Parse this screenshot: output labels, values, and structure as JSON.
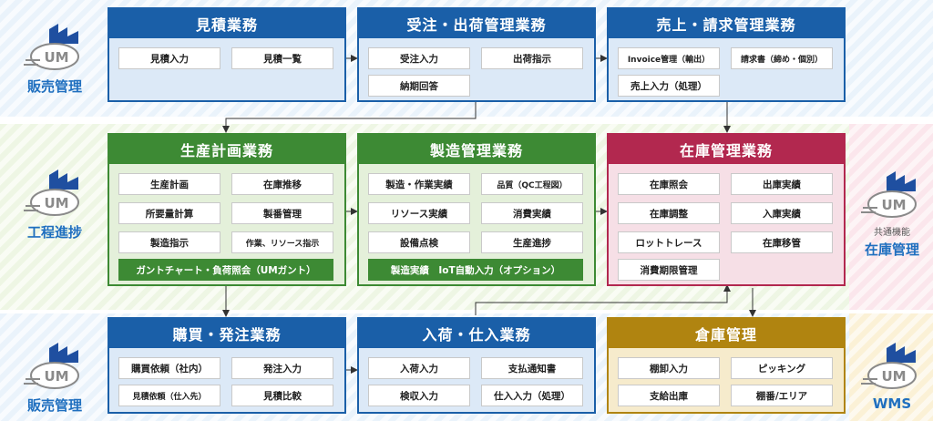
{
  "side_labels": {
    "top": "販売管理",
    "mid": "工程進捗",
    "bot": "販売管理",
    "right_mid_sub": "共通機能",
    "right_mid": "在庫管理",
    "right_bot": "WMS",
    "logo_text": "UM"
  },
  "boxes": {
    "mitsumori": {
      "title": "見積業務",
      "items": [
        "見積入力",
        "見積一覧"
      ]
    },
    "juchu": {
      "title": "受注・出荷管理業務",
      "items": [
        "受注入力",
        "出荷指示",
        "納期回答"
      ]
    },
    "uriage": {
      "title": "売上・請求管理業務",
      "items": [
        "Invoice管理（輸出）",
        "請求書（締め・個別）",
        "売上入力（処理）"
      ]
    },
    "seisan": {
      "title": "生産計画業務",
      "items": [
        "生産計画",
        "在庫推移",
        "所要量計算",
        "製番管理",
        "製造指示",
        "作業、リソース指示"
      ],
      "bar": "ガントチャート・負荷照会（UMガント）"
    },
    "seizo": {
      "title": "製造管理業務",
      "items": [
        "製造・作業実績",
        "品質（QC工程図）",
        "リソース実績",
        "消費実績",
        "設備点検",
        "生産進捗"
      ],
      "bar": "製造実績　IoT自動入力（オプション）"
    },
    "zaiko": {
      "title": "在庫管理業務",
      "items": [
        "在庫照会",
        "出庫実績",
        "在庫調整",
        "入庫実績",
        "ロットトレース",
        "在庫移管",
        "消費期限管理"
      ]
    },
    "konyu": {
      "title": "購買・発注業務",
      "items": [
        "購買依頼（社内）",
        "発注入力",
        "見積依頼（仕入先）",
        "見積比較"
      ]
    },
    "nyuka": {
      "title": "入荷・仕入業務",
      "items": [
        "入荷入力",
        "支払通知書",
        "検収入力",
        "仕入入力（処理）"
      ]
    },
    "soko": {
      "title": "倉庫管理",
      "items": [
        "棚卸入力",
        "ピッキング",
        "支給出庫",
        "棚番/エリア"
      ]
    }
  },
  "colors": {
    "blue": "#1a5fa8",
    "green": "#3d8a34",
    "red": "#b2284f",
    "gold": "#b08410"
  }
}
